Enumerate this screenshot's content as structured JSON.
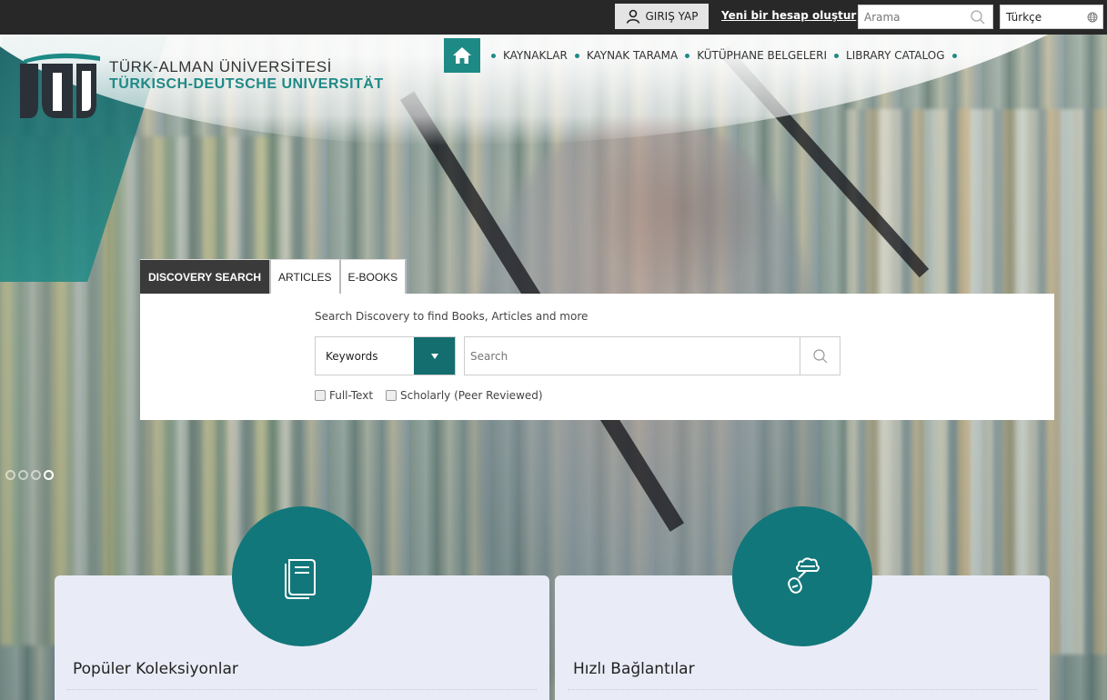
{
  "topbar": {
    "login_label": "GIRIŞ YAP",
    "register_label": "Yeni bir hesap oluştur",
    "search_placeholder": "Arama",
    "language": "Türkçe"
  },
  "logo": {
    "line1": "TÜRK-ALMAN ÜNİVERSİTESİ",
    "line2": "TÜRKISCH-DEUTSCHE UNIVERSITÄT"
  },
  "nav": {
    "items": [
      {
        "label": "KAYNAKLAR"
      },
      {
        "label": "KAYNAK TARAMA"
      },
      {
        "label": "KÜTÜPHANE BELGELERI"
      },
      {
        "label": "LIBRARY CATALOG"
      }
    ]
  },
  "discovery": {
    "tabs": [
      {
        "label": "DISCOVERY SEARCH",
        "active": true
      },
      {
        "label": "ARTICLES",
        "active": false
      },
      {
        "label": "E-BOOKS",
        "active": false
      }
    ],
    "hint": "Search Discovery to find Books, Articles and more",
    "field_select": "Keywords",
    "query_placeholder": "Search",
    "limiters": [
      "Full-Text",
      "Scholarly (Peer Reviewed)"
    ]
  },
  "slider": {
    "dot_count": 4,
    "active_index": 3
  },
  "cards": [
    {
      "title": "Popüler Koleksiyonlar",
      "icon": "books-icon"
    },
    {
      "title": "Hızlı Bağlantılar",
      "icon": "link-cloud-icon"
    }
  ],
  "colors": {
    "accent": "#1e8a86",
    "accent_dark": "#146d6f",
    "topbar": "#282828",
    "card_bg": "#e9ebf6"
  }
}
